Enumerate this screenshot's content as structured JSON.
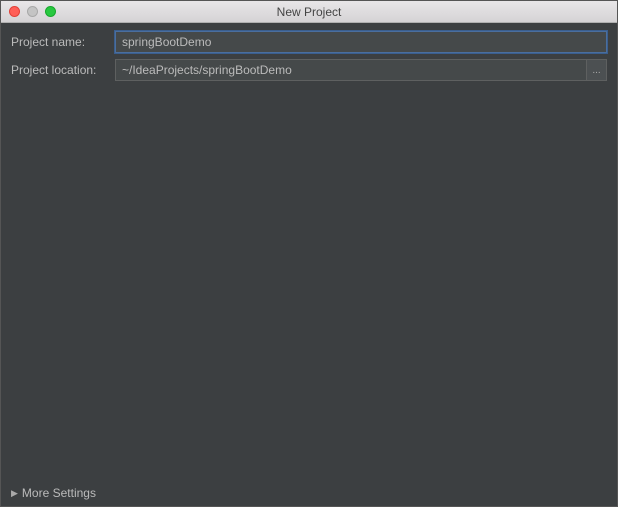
{
  "window": {
    "title": "New Project"
  },
  "form": {
    "project_name_label": "Project name:",
    "project_name_value": "springBootDemo",
    "project_location_label": "Project location:",
    "project_location_value": "~/IdeaProjects/springBootDemo",
    "browse_label": "..."
  },
  "footer": {
    "more_settings_label": "More Settings"
  }
}
